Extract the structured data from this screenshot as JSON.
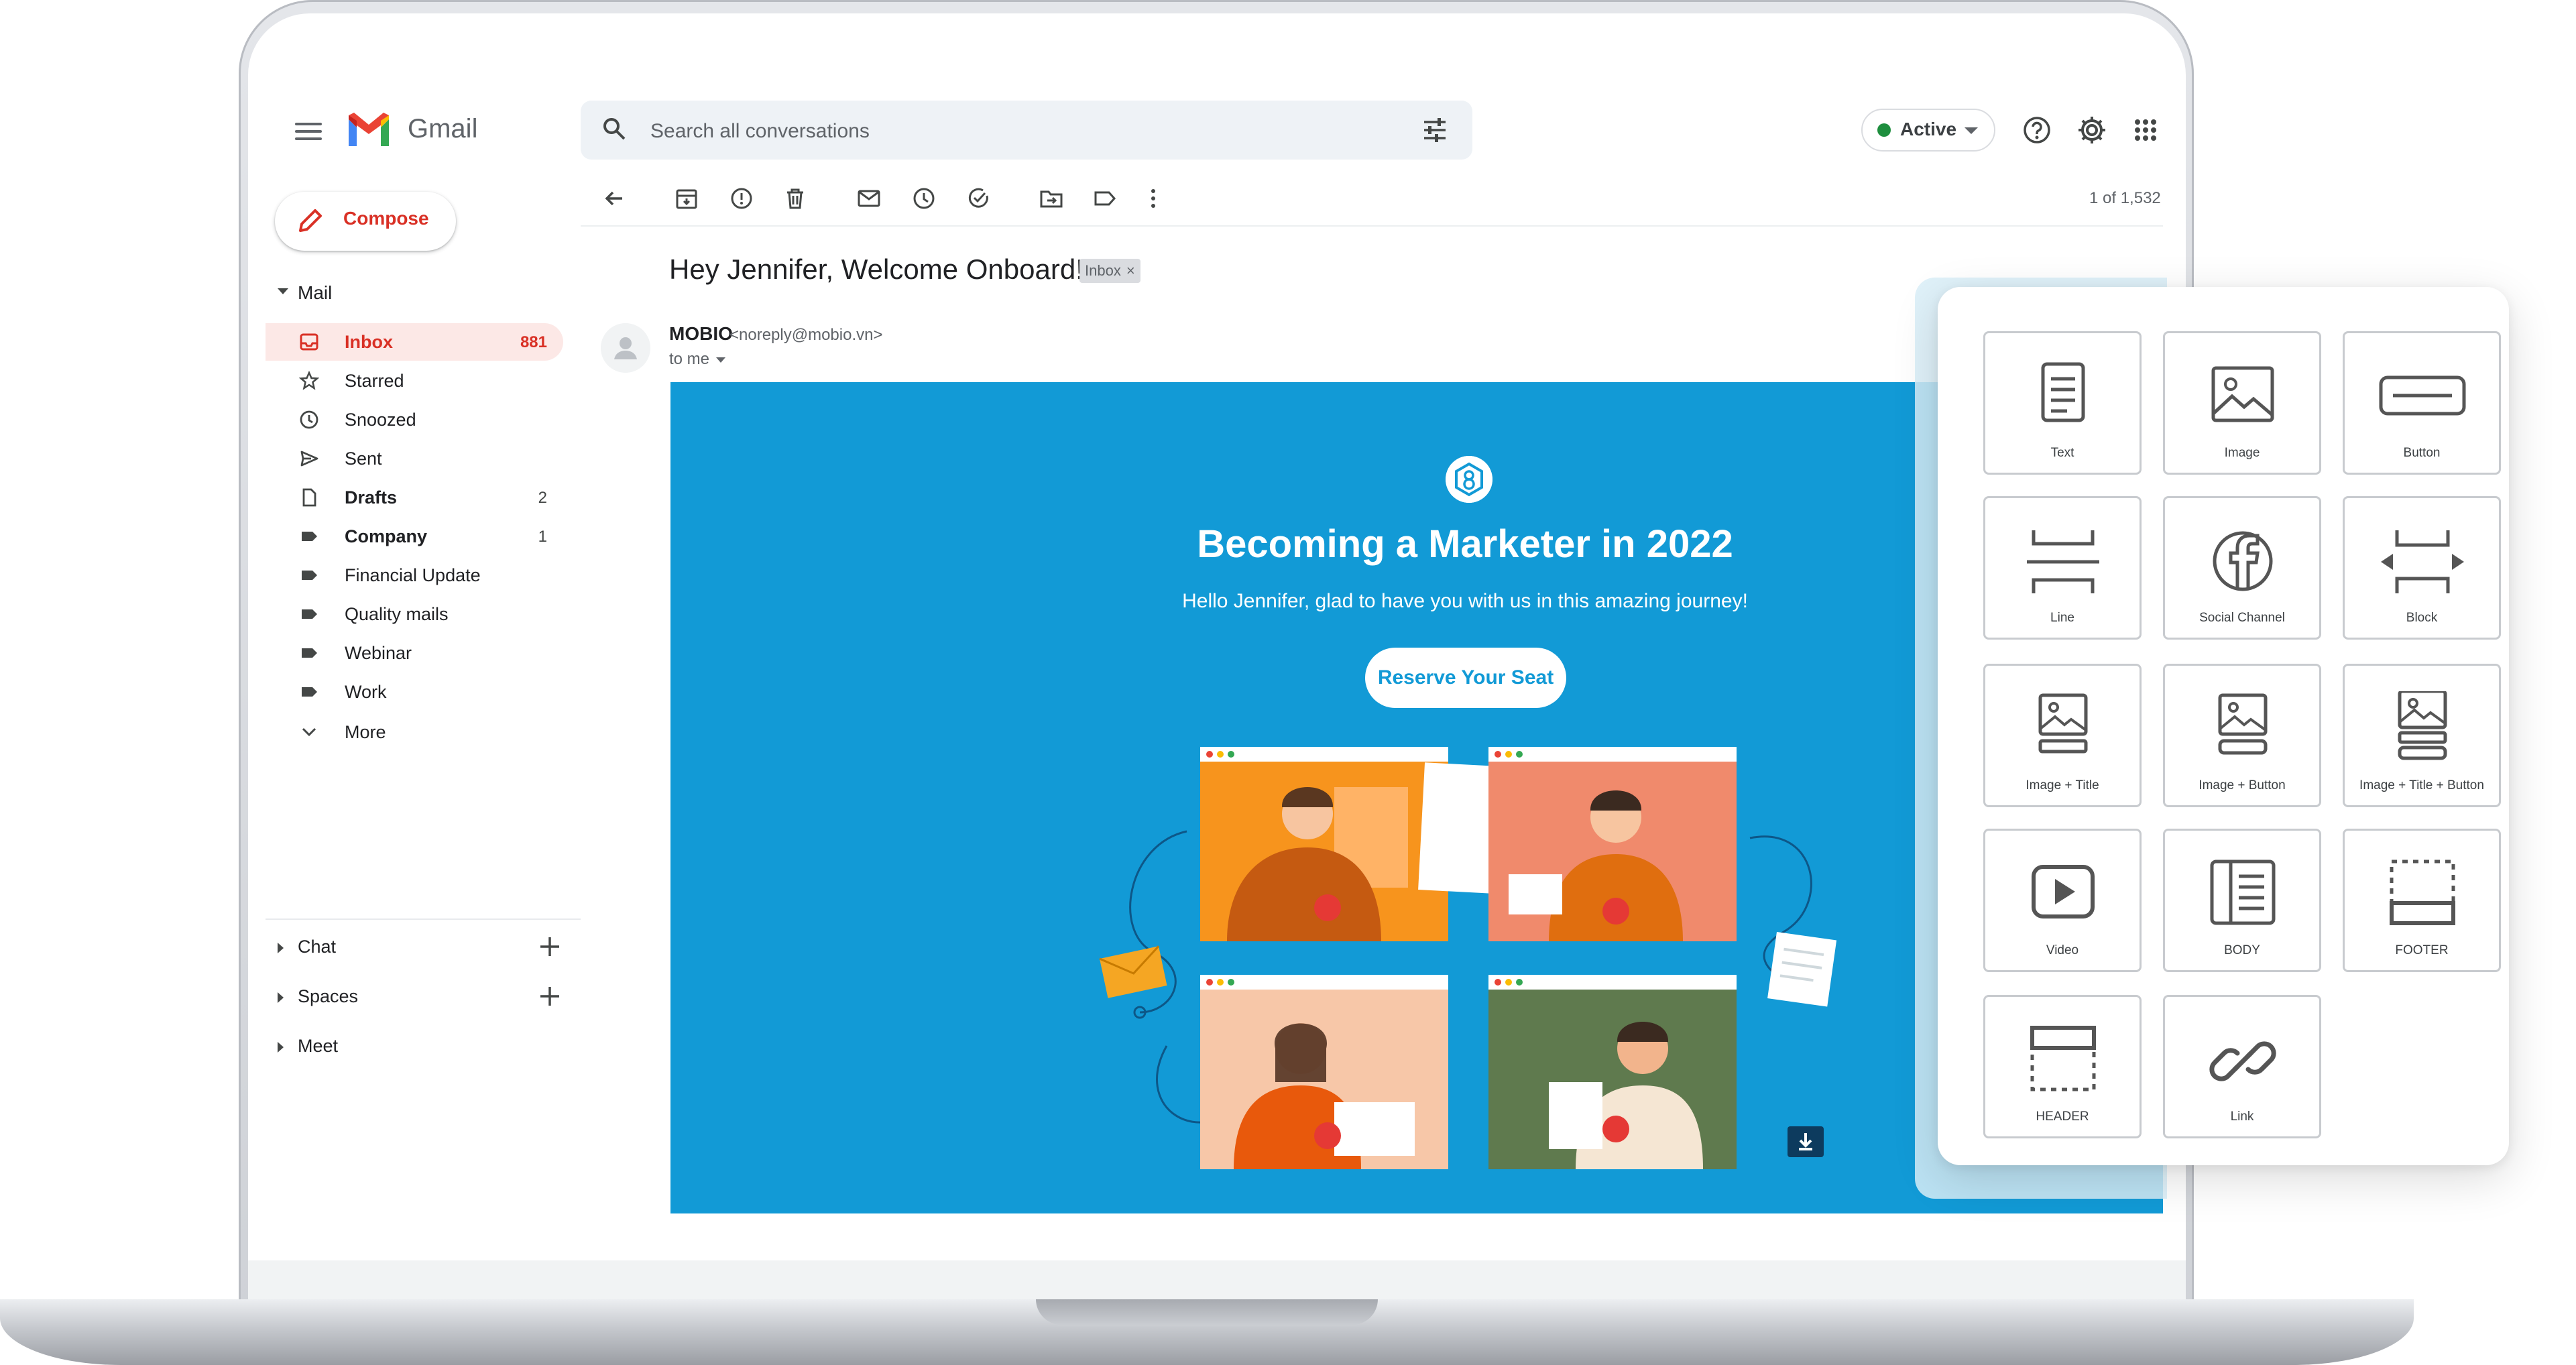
{
  "app": {
    "name": "Gmail"
  },
  "search": {
    "placeholder": "Search all conversations"
  },
  "status": {
    "label": "Active",
    "color": "#1e8e3e"
  },
  "compose": {
    "label": "Compose"
  },
  "mail_section": {
    "label": "Mail"
  },
  "sidebar": {
    "items": [
      {
        "label": "Inbox",
        "count": "881",
        "icon": "inbox-icon",
        "active": true,
        "bold": true
      },
      {
        "label": "Starred",
        "count": "",
        "icon": "star-icon"
      },
      {
        "label": "Snoozed",
        "count": "",
        "icon": "clock-icon"
      },
      {
        "label": "Sent",
        "count": "",
        "icon": "send-icon"
      },
      {
        "label": "Drafts",
        "count": "2",
        "icon": "draft-icon",
        "bold": true
      },
      {
        "label": "Company",
        "count": "1",
        "icon": "label-icon",
        "bold": true
      },
      {
        "label": "Financial Update",
        "count": "",
        "icon": "label-icon"
      },
      {
        "label": "Quality mails",
        "count": "",
        "icon": "label-icon"
      },
      {
        "label": "Webinar",
        "count": "",
        "icon": "label-icon"
      },
      {
        "label": "Work",
        "count": "",
        "icon": "label-icon"
      },
      {
        "label": "More",
        "count": "",
        "icon": "chevron-down-icon"
      }
    ],
    "sections": [
      {
        "label": "Chat"
      },
      {
        "label": "Spaces"
      },
      {
        "label": "Meet"
      }
    ]
  },
  "toolbar": {
    "pagination": "1 of 1,532"
  },
  "message": {
    "subject": "Hey Jennifer, Welcome Onboard!",
    "chip": "Inbox",
    "chip_close": "×",
    "sender_name": "MOBIO",
    "sender_email": "<noreply@mobio.vn>",
    "recipient": "to me"
  },
  "banner": {
    "title": "Becoming a Marketer in 2022",
    "subtitle": "Hello Jennifer, glad to have you with us in this amazing journey!",
    "button": "Reserve Your Seat",
    "background": "#129ad6"
  },
  "blocks": [
    {
      "label": "Text",
      "icon": "text-block-icon"
    },
    {
      "label": "Image",
      "icon": "image-block-icon"
    },
    {
      "label": "Button",
      "icon": "button-block-icon"
    },
    {
      "label": "Line",
      "icon": "line-block-icon"
    },
    {
      "label": "Social Channel",
      "icon": "facebook-icon"
    },
    {
      "label": "Block",
      "icon": "block-icon"
    },
    {
      "label": "Image + Title",
      "icon": "image-title-icon"
    },
    {
      "label": "Image + Button",
      "icon": "image-button-icon"
    },
    {
      "label": "Image + Title + Button",
      "icon": "image-title-button-icon"
    },
    {
      "label": "Video",
      "icon": "video-icon"
    },
    {
      "label": "BODY",
      "icon": "body-icon"
    },
    {
      "label": "FOOTER",
      "icon": "footer-icon"
    },
    {
      "label": "HEADER",
      "icon": "header-icon"
    },
    {
      "label": "Link",
      "icon": "link-icon"
    }
  ]
}
